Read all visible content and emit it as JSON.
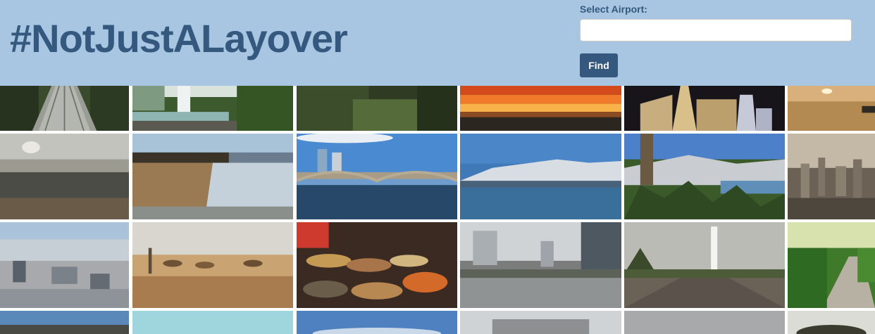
{
  "header": {
    "title": "#NotJustALayover",
    "select_label": "Select Airport:",
    "airport_input_value": "",
    "find_label": "Find",
    "colors": {
      "background": "#a8c6e2",
      "title": "#35597e",
      "button": "#35597e"
    }
  },
  "gallery": {
    "photos": [
      "rope-bridge-forest",
      "waterfall-jungle",
      "forest-foliage",
      "sunset-sky",
      "cathedral-night",
      "sunset-water",
      "waterfall-misty-sky",
      "iguazu-falls",
      "arch-bridge-city",
      "snowy-mountains-lake",
      "pine-forest-lake",
      "hazy-city-skyline",
      "aerial-city",
      "desert-camels",
      "spice-market",
      "city-riverfront",
      "monument-road",
      "garden-walkway",
      "coast-blue",
      "sky-turquoise",
      "blue-sky-clouds",
      "city-building-grey",
      "grey-sky",
      "dark-tree"
    ]
  }
}
